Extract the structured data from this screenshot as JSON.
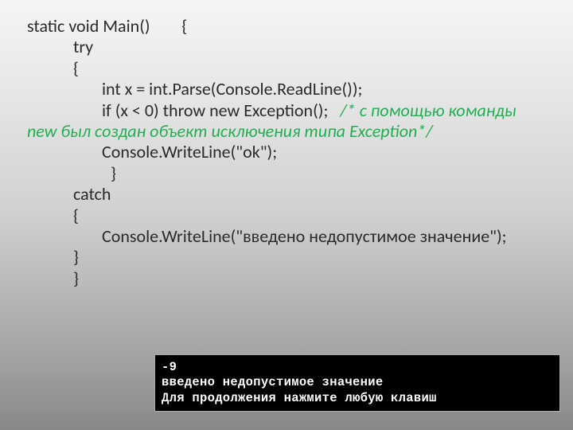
{
  "code": {
    "l1": "static void Main()        {",
    "l2": "try",
    "l3": "{",
    "l4": "int x = int.Parse(Console.ReadLine());",
    "l5a": "if (x < 0) throw new Exception();",
    "comment_start": "/* с помощью команды ",
    "comment_new": "new",
    "comment_mid": " был создан объект исключения типа ",
    "comment_ex": "Exception*/",
    "l6": "Console.WriteLine(\"ok\");",
    "l7": " }",
    "l8": "catch",
    "l9": "{",
    "l10": "Console.WriteLine(\"введено недопустимое значение\");",
    "l11": "}",
    "l12": "}"
  },
  "console": {
    "r1": "-9",
    "r2": "введено недопустимое значение",
    "r3": "Для продолжения нажмите любую клавиш"
  }
}
